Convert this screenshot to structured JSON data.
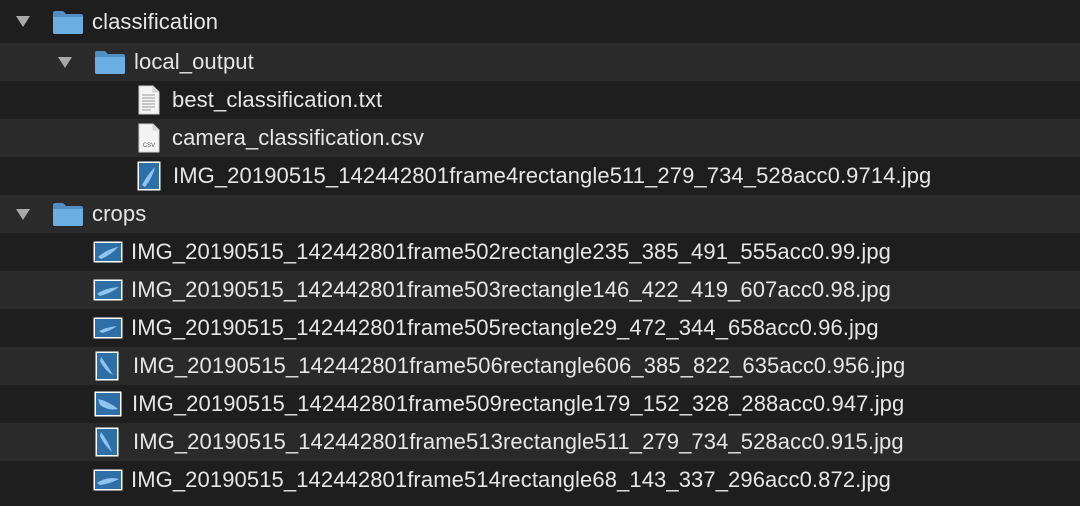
{
  "tree": {
    "classification": {
      "name": "classification",
      "icon": "folder-icon",
      "expanded": true
    },
    "local_output": {
      "name": "local_output",
      "icon": "folder-icon",
      "expanded": true,
      "files": [
        {
          "name": "best_classification.txt",
          "icon": "text-document-icon"
        },
        {
          "name": "camera_classification.csv",
          "icon": "csv-document-icon",
          "icon_text": "CSV"
        },
        {
          "name": "IMG_20190515_142442801frame4rectangle511_279_734_528acc0.9714.jpg",
          "icon": "image-thumbnail-icon"
        }
      ]
    },
    "crops": {
      "name": "crops",
      "icon": "folder-icon",
      "expanded": true,
      "files": [
        {
          "name": "IMG_20190515_142442801frame502rectangle235_385_491_555acc0.99.jpg",
          "icon": "image-thumbnail-icon"
        },
        {
          "name": "IMG_20190515_142442801frame503rectangle146_422_419_607acc0.98.jpg",
          "icon": "image-thumbnail-icon"
        },
        {
          "name": "IMG_20190515_142442801frame505rectangle29_472_344_658acc0.96.jpg",
          "icon": "image-thumbnail-icon"
        },
        {
          "name": "IMG_20190515_142442801frame506rectangle606_385_822_635acc0.956.jpg",
          "icon": "image-thumbnail-icon"
        },
        {
          "name": "IMG_20190515_142442801frame509rectangle179_152_328_288acc0.947.jpg",
          "icon": "image-thumbnail-icon"
        },
        {
          "name": "IMG_20190515_142442801frame513rectangle511_279_734_528acc0.915.jpg",
          "icon": "image-thumbnail-icon"
        },
        {
          "name": "IMG_20190515_142442801frame514rectangle68_143_337_296acc0.872.jpg",
          "icon": "image-thumbnail-icon"
        }
      ]
    }
  },
  "colors": {
    "background": "#1e1e1e",
    "alt_row": "#2a2a2a",
    "text": "#e6e6e6",
    "folder_blue": "#5fa3da",
    "disclosure": "#a9a9a9"
  }
}
